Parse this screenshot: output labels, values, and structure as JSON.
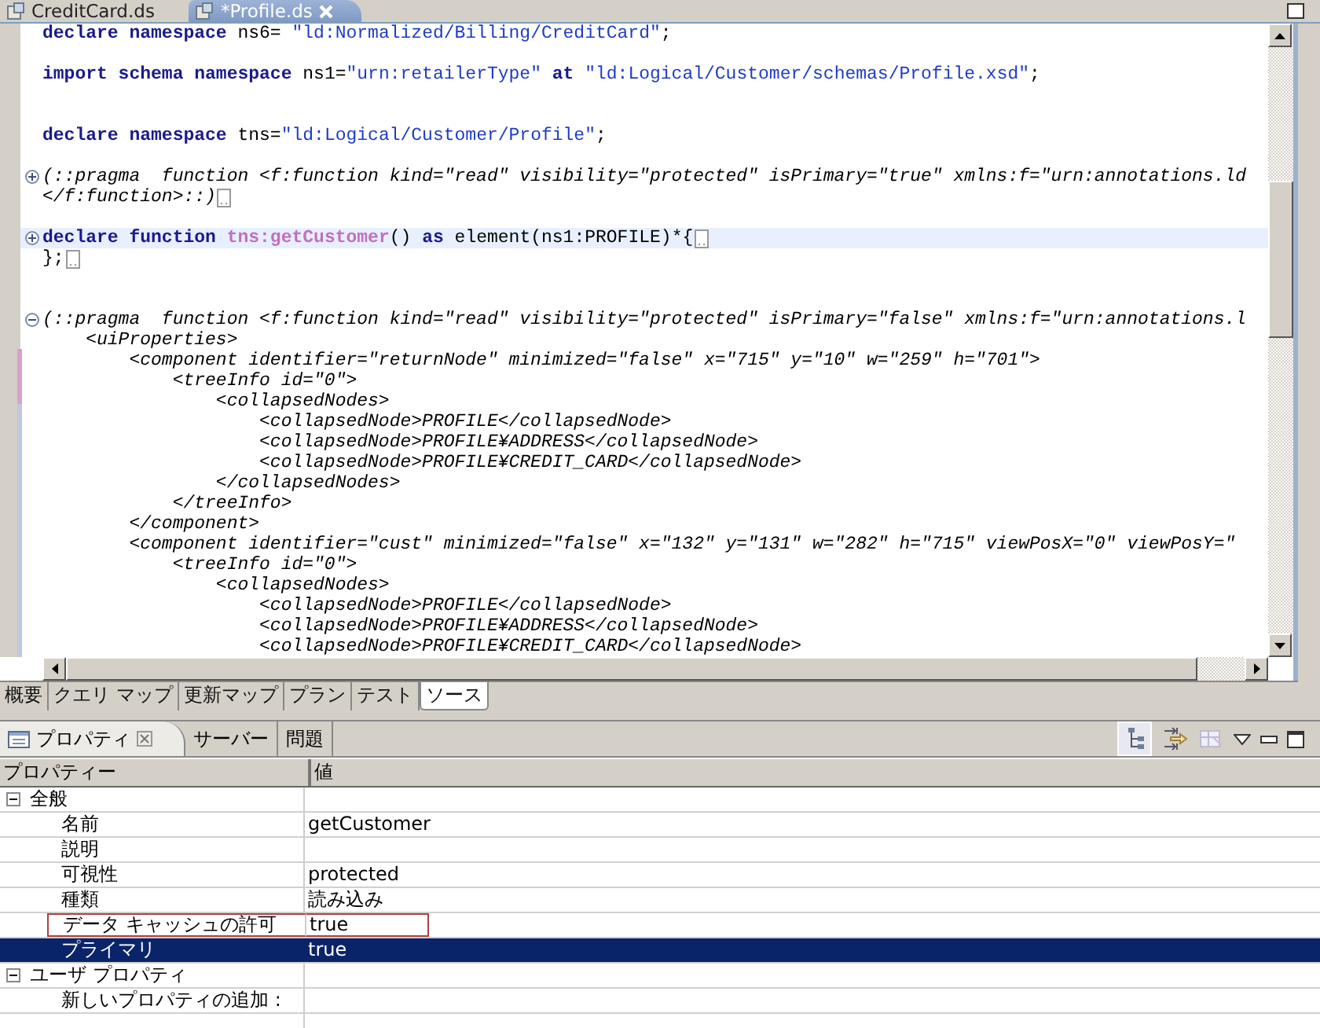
{
  "editor_tabs": [
    {
      "label": "CreditCard.ds",
      "selected": false
    },
    {
      "label": "*Profile.ds",
      "selected": true
    }
  ],
  "code_lines": [
    {
      "blank_after": true,
      "parts": [
        {
          "kind": "keyword",
          "text": "declare namespace"
        },
        {
          "kind": "plain",
          "text": " ns6= "
        },
        {
          "kind": "string",
          "text": "\"ld:Normalized/Billing/CreditCard\""
        },
        {
          "kind": "plain",
          "text": ";"
        }
      ]
    },
    {
      "blank_after": true,
      "second_blank_after": true,
      "parts": [
        {
          "kind": "keyword",
          "text": "import schema namespace"
        },
        {
          "kind": "plain",
          "text": " ns1="
        },
        {
          "kind": "string",
          "text": "\"urn:retailerType\""
        },
        {
          "kind": "keyword",
          "text": " at "
        },
        {
          "kind": "string",
          "text": "\"ld:Logical/Customer/schemas/Profile.xsd\""
        },
        {
          "kind": "plain",
          "text": ";"
        }
      ]
    },
    {
      "blank_after": true,
      "parts": [
        {
          "kind": "keyword",
          "text": "declare namespace"
        },
        {
          "kind": "plain",
          "text": " tns="
        },
        {
          "kind": "string",
          "text": "\"ld:Logical/Customer/Profile\""
        },
        {
          "kind": "plain",
          "text": ";"
        }
      ]
    },
    {
      "region_collapsed": true,
      "parts": [
        {
          "kind": "comment",
          "text": "(::pragma  function <f:function kind=\"read\" visibility=\"protected\" isPrimary=\"true\" xmlns:f=\"urn:annotations.ld"
        }
      ]
    },
    {
      "folded": true,
      "blank_after": true,
      "parts": [
        {
          "kind": "comment",
          "text": "</f:function>::)"
        }
      ]
    },
    {
      "region_collapsed": true,
      "current": true,
      "folded": true,
      "parts": [
        {
          "kind": "keyword",
          "text": "declare function "
        },
        {
          "kind": "function",
          "text": "tns:getCustomer"
        },
        {
          "kind": "plain",
          "text": "() "
        },
        {
          "kind": "keyword",
          "text": "as"
        },
        {
          "kind": "plain",
          "text": " element(ns1:PROFILE)*{"
        }
      ]
    },
    {
      "folded": true,
      "blank_after": true,
      "second_blank_after": true,
      "parts": [
        {
          "kind": "plain",
          "text": "};"
        }
      ]
    },
    {
      "region_collapsed": false,
      "parts": [
        {
          "kind": "comment",
          "text": "(::pragma  function <f:function kind=\"read\" visibility=\"protected\" isPrimary=\"false\" xmlns:f=\"urn:annotations.l"
        }
      ]
    },
    {
      "parts": [
        {
          "kind": "comment",
          "text": "    <uiProperties>"
        }
      ]
    },
    {
      "parts": [
        {
          "kind": "comment",
          "text": "        <component identifier=\"returnNode\" minimized=\"false\" x=\"715\" y=\"10\" w=\"259\" h=\"701\">"
        }
      ]
    },
    {
      "parts": [
        {
          "kind": "comment",
          "text": "            <treeInfo id=\"0\">"
        }
      ]
    },
    {
      "parts": [
        {
          "kind": "comment",
          "text": "                <collapsedNodes>"
        }
      ]
    },
    {
      "parts": [
        {
          "kind": "comment",
          "text": "                    <collapsedNode>PROFILE</collapsedNode>"
        }
      ]
    },
    {
      "parts": [
        {
          "kind": "comment",
          "text": "                    <collapsedNode>PROFILE¥ADDRESS</collapsedNode>"
        }
      ]
    },
    {
      "parts": [
        {
          "kind": "comment",
          "text": "                    <collapsedNode>PROFILE¥CREDIT_CARD</collapsedNode>"
        }
      ]
    },
    {
      "parts": [
        {
          "kind": "comment",
          "text": "                </collapsedNodes>"
        }
      ]
    },
    {
      "parts": [
        {
          "kind": "comment",
          "text": "            </treeInfo>"
        }
      ]
    },
    {
      "parts": [
        {
          "kind": "comment",
          "text": "        </component>"
        }
      ]
    },
    {
      "parts": [
        {
          "kind": "comment",
          "text": "        <component identifier=\"cust\" minimized=\"false\" x=\"132\" y=\"131\" w=\"282\" h=\"715\" viewPosX=\"0\" viewPosY=\""
        }
      ]
    },
    {
      "parts": [
        {
          "kind": "comment",
          "text": "            <treeInfo id=\"0\">"
        }
      ]
    },
    {
      "parts": [
        {
          "kind": "comment",
          "text": "                <collapsedNodes>"
        }
      ]
    },
    {
      "parts": [
        {
          "kind": "comment",
          "text": "                    <collapsedNode>PROFILE</collapsedNode>"
        }
      ]
    },
    {
      "parts": [
        {
          "kind": "comment",
          "text": "                    <collapsedNode>PROFILE¥ADDRESS</collapsedNode>"
        }
      ]
    },
    {
      "parts": [
        {
          "kind": "comment",
          "text": "                    <collapsedNode>PROFILE¥CREDIT_CARD</collapsedNode>"
        }
      ]
    }
  ],
  "page_tabs": [
    {
      "label": "概要",
      "selected": false
    },
    {
      "label": "クエリ マップ",
      "selected": false
    },
    {
      "label": "更新マップ",
      "selected": false
    },
    {
      "label": "プラン",
      "selected": false
    },
    {
      "label": "テスト",
      "selected": false
    },
    {
      "label": "ソース",
      "selected": true
    }
  ],
  "view_tabs": [
    {
      "label": "プロパティ",
      "selected": true
    },
    {
      "label": "サーバー",
      "selected": false
    },
    {
      "label": "問題",
      "selected": false
    }
  ],
  "properties": {
    "columns": [
      "プロパティー",
      "値"
    ],
    "groups": [
      {
        "name": "全般",
        "expanded": true,
        "children": [
          {
            "name": "名前",
            "value": "getCustomer",
            "selected": false,
            "outlined": false
          },
          {
            "name": "説明",
            "selected": false,
            "outlined": false
          },
          {
            "name": "可視性",
            "value": "protected",
            "selected": false,
            "outlined": false
          },
          {
            "name": "種類",
            "value": "読み込み",
            "selected": false,
            "outlined": false
          },
          {
            "name": "データ キャッシュの許可",
            "value": "true",
            "selected": false,
            "outlined": true
          },
          {
            "name": "プライマリ",
            "value": "true",
            "selected": true,
            "outlined": false
          }
        ]
      },
      {
        "name": "ユーザ プロパティ",
        "expanded": true,
        "children": [
          {
            "name": "新しいプロパティの追加 :",
            "selected": false,
            "outlined": false
          }
        ]
      }
    ]
  }
}
